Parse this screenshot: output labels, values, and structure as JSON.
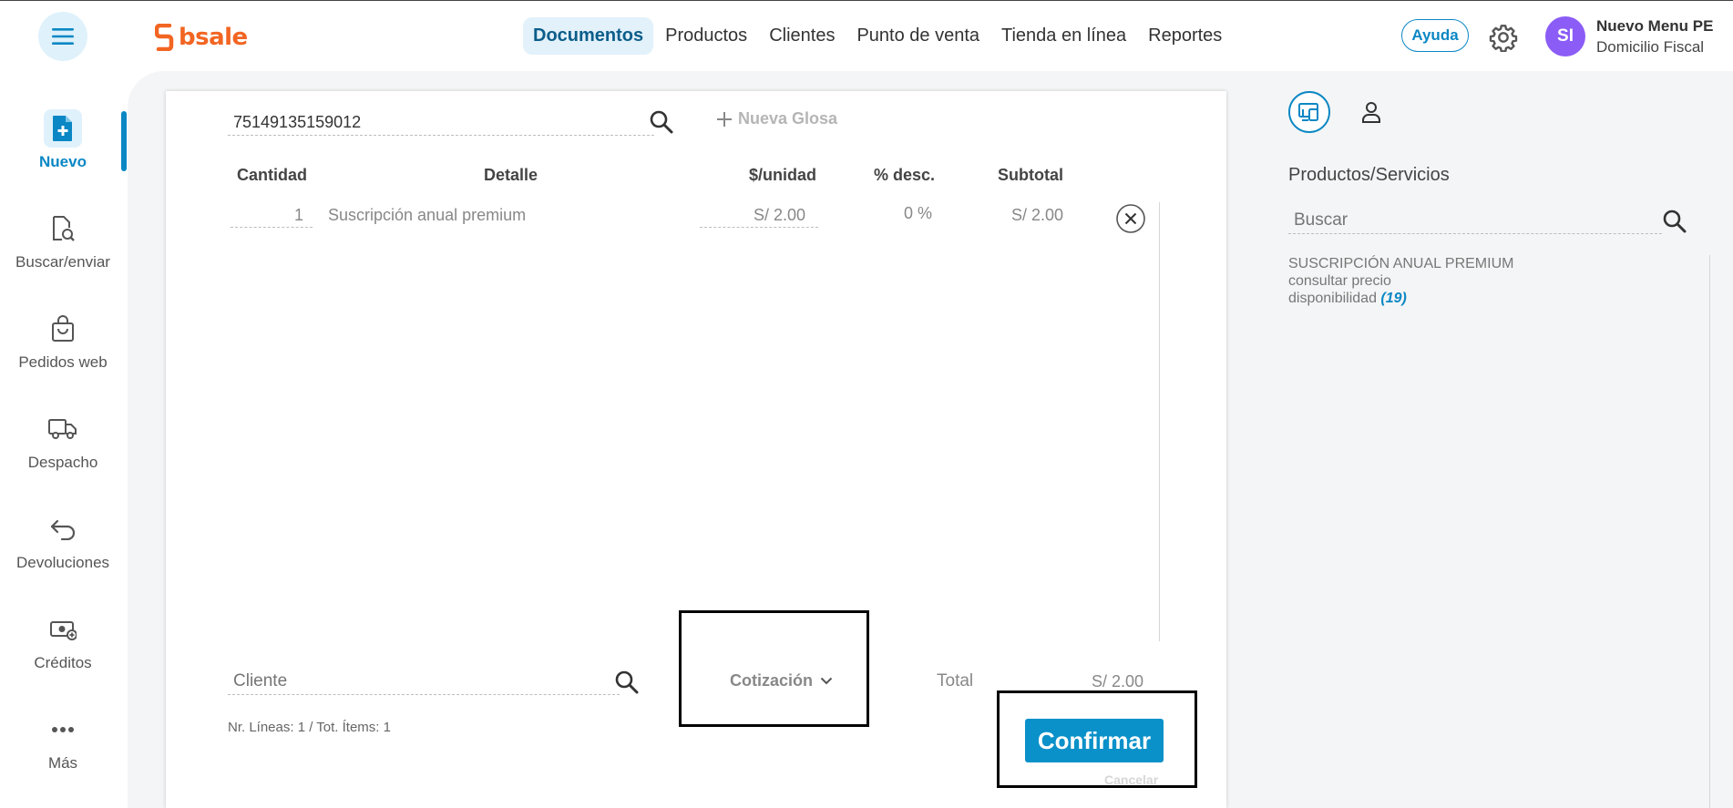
{
  "brand": {
    "name": "bsale",
    "color": "#f26522",
    "accent": "#0a87c4"
  },
  "nav": {
    "items": [
      {
        "label": "Documentos",
        "active": true
      },
      {
        "label": "Productos"
      },
      {
        "label": "Clientes"
      },
      {
        "label": "Punto de venta"
      },
      {
        "label": "Tienda en línea"
      },
      {
        "label": "Reportes"
      }
    ]
  },
  "header": {
    "help_label": "Ayuda",
    "avatar_initials": "SI",
    "user_name": "Nuevo Menu PE",
    "user_sub": "Domicilio Fiscal"
  },
  "sidebar": {
    "items": [
      {
        "label": "Nuevo",
        "icon": "new-document-icon",
        "active": true
      },
      {
        "label": "Buscar/enviar",
        "icon": "search-document-icon"
      },
      {
        "label": "Pedidos web",
        "icon": "shopping-bag-icon"
      },
      {
        "label": "Despacho",
        "icon": "truck-icon"
      },
      {
        "label": "Devoluciones",
        "icon": "return-arrow-icon"
      },
      {
        "label": "Créditos",
        "icon": "money-icon"
      },
      {
        "label": "Más",
        "icon": "more-dots-icon"
      }
    ]
  },
  "document": {
    "barcode_value": "75149135159012",
    "new_gloss_label": "Nueva Glosa",
    "columns": {
      "quantity": "Cantidad",
      "detail": "Detalle",
      "unit_price": "$/unidad",
      "discount": "% desc.",
      "subtotal": "Subtotal"
    },
    "lines": [
      {
        "quantity": "1",
        "detail": "Suscripción anual premium",
        "unit_price": "S/ 2.00",
        "discount": "0 %",
        "subtotal": "S/ 2.00"
      }
    ],
    "client_placeholder": "Cliente",
    "doc_type": "Cotización",
    "total_label": "Total",
    "total_value": "S/ 2.00",
    "summary": "Nr. Líneas: 1 / Tot. Ítems: 1",
    "confirm_label": "Confirmar",
    "cancel_label": "Cancelar"
  },
  "right_panel": {
    "title": "Productos/Servicios",
    "search_placeholder": "Buscar",
    "product": {
      "name": "SUSCRIPCIÓN ANUAL PREMIUM",
      "price": "consultar precio",
      "availability_label": "disponibilidad",
      "availability_count": "(19)"
    }
  }
}
